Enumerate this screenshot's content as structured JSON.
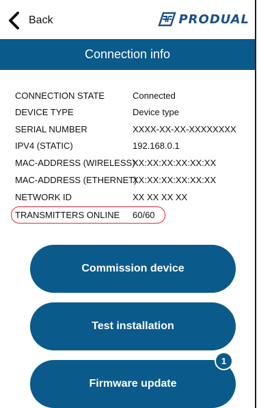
{
  "header": {
    "back_label": "Back",
    "back_icon": "chevron-left-icon",
    "brand_name": "PRODUAL",
    "brand_color": "#1d4f87"
  },
  "page": {
    "title": "Connection info",
    "accent_color": "#0b5a8c"
  },
  "connection_info": {
    "rows": [
      {
        "key": "CONNECTION STATE",
        "value": "Connected"
      },
      {
        "key": "DEVICE TYPE",
        "value": "Device type"
      },
      {
        "key": "SERIAL NUMBER",
        "value": "XXXX-XX-XX-XXXXXXXX"
      },
      {
        "key": "IPV4 (STATIC)",
        "value": "192.168.0.1"
      },
      {
        "key": "MAC-ADDRESS (WIRELESS)",
        "value": "XX:XX:XX:XX:XX:XX"
      },
      {
        "key": "MAC-ADDRESS (ETHERNET)",
        "value": "XX:XX:XX:XX:XX:XX"
      },
      {
        "key": "NETWORK ID",
        "value": "XX XX XX XX"
      },
      {
        "key": "TRANSMITTERS ONLINE",
        "value": "60/60"
      }
    ],
    "highlight_color": "#e2263b"
  },
  "actions": {
    "commission_label": "Commission device",
    "test_label": "Test installation",
    "firmware_label": "Firmware update",
    "firmware_badge": "1"
  }
}
